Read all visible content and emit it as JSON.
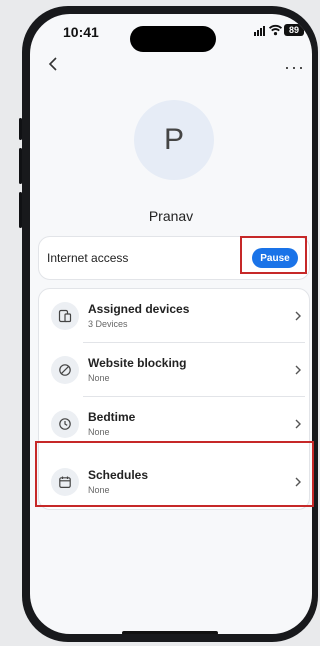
{
  "status_bar": {
    "time": "10:41",
    "battery": "89"
  },
  "profile": {
    "initial": "P",
    "name": "Pranav"
  },
  "internet_access": {
    "label": "Internet access",
    "pause_label": "Pause"
  },
  "settings_list": {
    "items": [
      {
        "title": "Assigned devices",
        "subtitle": "3 Devices",
        "icon": "devices-icon"
      },
      {
        "title": "Website blocking",
        "subtitle": "None",
        "icon": "block-icon"
      },
      {
        "title": "Bedtime",
        "subtitle": "None",
        "icon": "clock-icon"
      },
      {
        "title": "Schedules",
        "subtitle": "None",
        "icon": "calendar-icon"
      }
    ]
  },
  "colors": {
    "accent": "#1a73e8",
    "highlight": "#c62828",
    "background": "#f7f8fa"
  },
  "highlights": [
    "pause-button",
    "schedules-row"
  ]
}
